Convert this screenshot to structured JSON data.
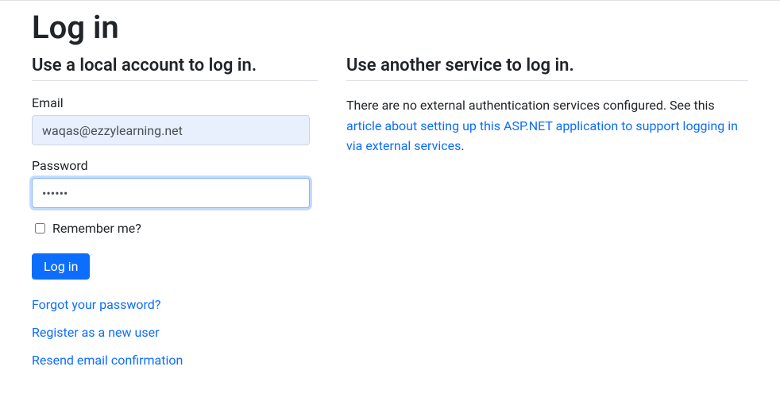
{
  "page": {
    "title": "Log in"
  },
  "local": {
    "header": "Use a local account to log in.",
    "email_label": "Email",
    "email_value": "waqas@ezzylearning.net",
    "password_label": "Password",
    "password_value": "••••••",
    "remember_label": "Remember me?",
    "remember_checked": false,
    "submit_label": "Log in",
    "links": {
      "forgot": "Forgot your password?",
      "register": "Register as a new user",
      "resend": "Resend email confirmation"
    }
  },
  "external": {
    "header": "Use another service to log in.",
    "message_prefix": "There are no external authentication services configured. See this ",
    "link_text": "article about setting up this ASP.NET application to support logging in via external services",
    "message_suffix": "."
  }
}
